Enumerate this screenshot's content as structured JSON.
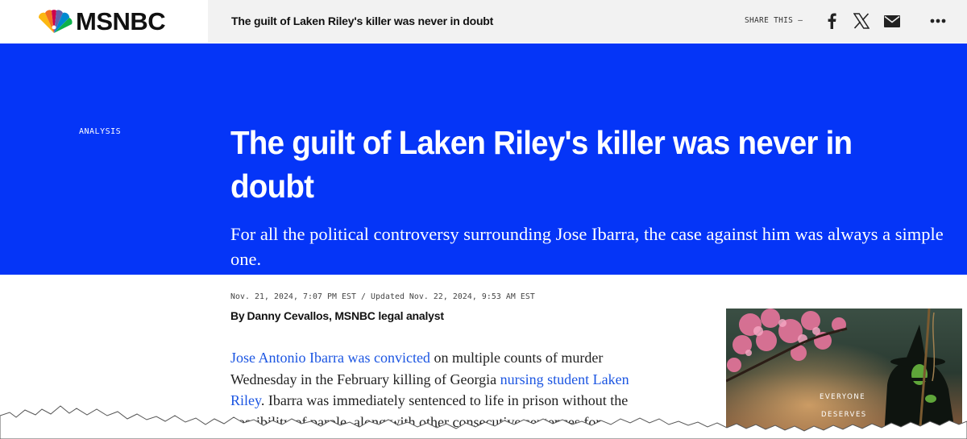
{
  "header": {
    "logo_text": "MSNBC",
    "title": "The guilt of Laken Riley's killer was never in doubt",
    "share_label": "SHARE THIS —",
    "icons": [
      "facebook-icon",
      "x-icon",
      "mail-icon",
      "more-icon"
    ]
  },
  "hero": {
    "eyebrow": "ANALYSIS",
    "headline": "The guilt of Laken Riley's killer was never in doubt",
    "dek": "For all the political controversy surrounding Jose Ibarra, the case against him was always a simple one.",
    "background": "#0535f7"
  },
  "meta": {
    "dateline": "Nov. 21, 2024, 7:07 PM EST / Updated Nov. 22, 2024, 9:53 AM EST",
    "byline_prefix": "By",
    "byline_author": "Danny Cevallos, MSNBC legal analyst"
  },
  "article": {
    "link1": "Jose Antonio Ibarra was convicted",
    "text1": " on multiple counts of murder Wednesday in the February killing of Georgia ",
    "link2": "nursing student Laken Riley",
    "text2": ". Ibarra was immediately sentenced to life in prison without the possibility of parole, along with other consecutive sentences for",
    "link_color": "#1b55e2"
  },
  "ad": {
    "line1": "EVERYONE",
    "line2": "DESERVES"
  }
}
